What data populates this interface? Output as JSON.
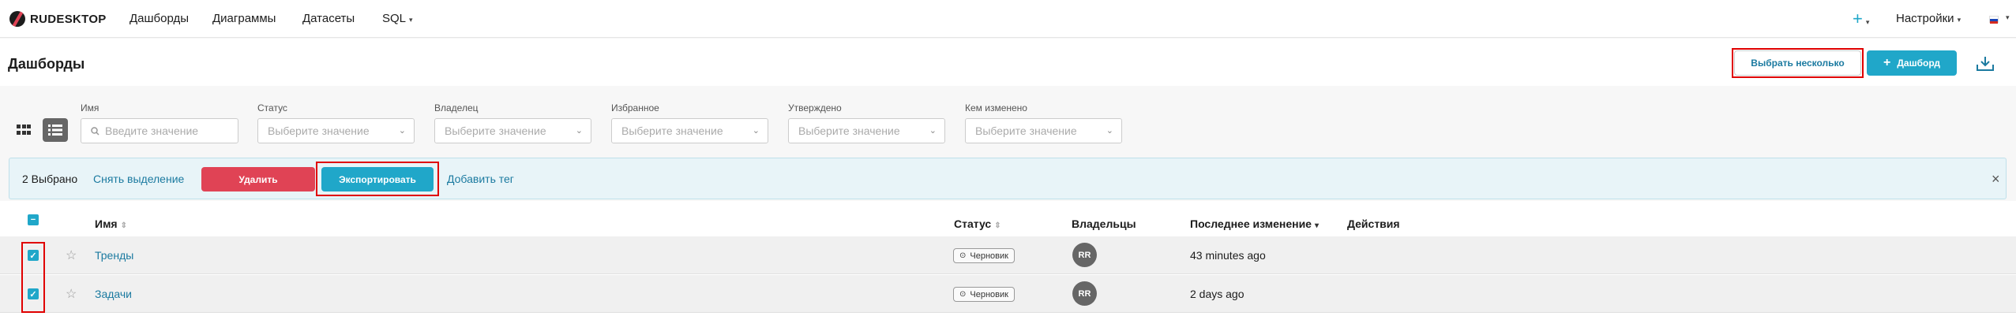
{
  "nav": {
    "logo": "RUDESKTOP",
    "items": [
      "Дашборды",
      "Диаграммы",
      "Датасеты",
      "SQL"
    ],
    "plus": "+",
    "settings": "Настройки"
  },
  "header": {
    "title": "Дашборды",
    "select_multiple": "Выбрать несколько",
    "add_dashboard": "Дашборд"
  },
  "filters": [
    {
      "label": "Имя",
      "placeholder": "Введите значение"
    },
    {
      "label": "Статус",
      "placeholder": "Выберите значение"
    },
    {
      "label": "Владелец",
      "placeholder": "Выберите значение"
    },
    {
      "label": "Избранное",
      "placeholder": "Выберите значение"
    },
    {
      "label": "Утверждено",
      "placeholder": "Выберите значение"
    },
    {
      "label": "Кем изменено",
      "placeholder": "Выберите значение"
    }
  ],
  "bulk": {
    "count": "2 Выбрано",
    "deselect": "Снять выделение",
    "delete": "Удалить",
    "export": "Экспортировать",
    "add_tag": "Добавить тег",
    "close": "×"
  },
  "table": {
    "headers": {
      "name": "Имя",
      "status": "Статус",
      "owners": "Владельцы",
      "modified": "Последнее изменение",
      "actions": "Действия"
    },
    "rows": [
      {
        "name": "Тренды",
        "status": "Черновик",
        "owner": "RR",
        "modified": "43 minutes ago"
      },
      {
        "name": "Задачи",
        "status": "Черновик",
        "owner": "RR",
        "modified": "2 days ago"
      }
    ]
  },
  "colors": {
    "accent": "#20a7c9",
    "danger": "#e04355",
    "link": "#1b7aa0",
    "highlight": "#e00000"
  }
}
